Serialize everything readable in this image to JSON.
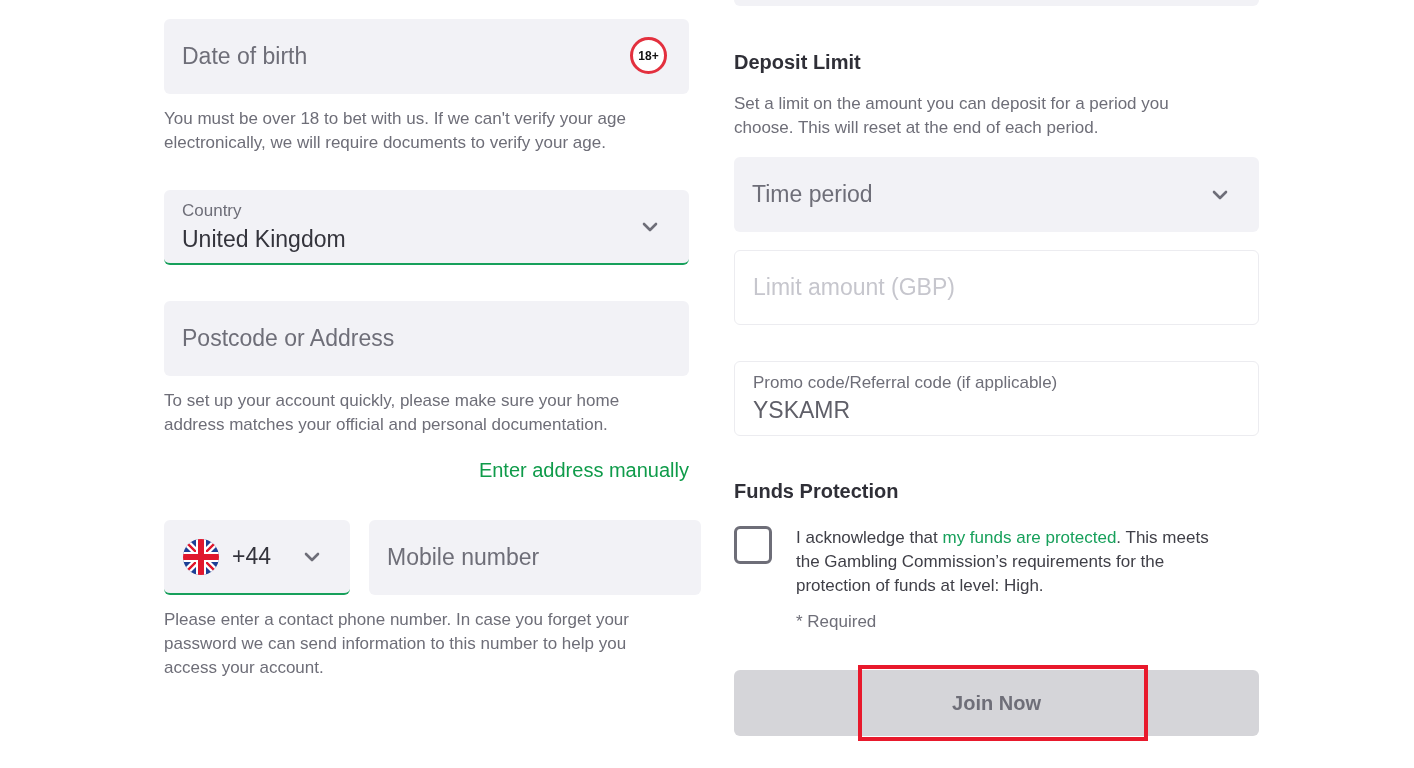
{
  "left_column": {
    "date_of_birth": {
      "placeholder": "Date of birth",
      "badge": "18+"
    },
    "date_of_birth_hint": "You must be over 18 to bet with us. If we can't verify your age electronically, we will require documents to verify your age.",
    "country": {
      "label": "Country",
      "value": "United Kingdom",
      "valid": true
    },
    "address": {
      "placeholder": "Postcode or Address"
    },
    "address_hint": "To set up your account quickly, please make sure your home address matches your official and personal documentation.",
    "manual_address_link": "Enter address manually",
    "phone": {
      "country_code": "+44",
      "country_code_valid": true,
      "placeholder": "Mobile number"
    },
    "phone_hint": "Please enter a contact phone number. In case you forget your password we can send information to this number to help you access your account."
  },
  "right_column": {
    "deposit_limit": {
      "heading": "Deposit Limit",
      "description": "Set a limit on the amount you can deposit for a period you choose. This will reset at the end of each period.",
      "time_period": {
        "placeholder": "Time period"
      },
      "limit_amount": {
        "placeholder": "Limit amount (GBP)",
        "disabled": true
      }
    },
    "promo_code": {
      "label": "Promo code/Referral code (if applicable)",
      "value": "YSKAMR"
    },
    "funds_protection": {
      "heading": "Funds Protection",
      "checked": false,
      "statement": [
        {
          "kind": "text",
          "text": "I acknowledge that "
        },
        {
          "kind": "link",
          "text": "my funds are protected"
        },
        {
          "kind": "text",
          "text": ". This meets the Gambling Commission’s requirements for the protection of funds at level: High."
        }
      ],
      "required_note": "* Required"
    },
    "join_button": {
      "label": "Join Now",
      "highlighted": true
    }
  }
}
